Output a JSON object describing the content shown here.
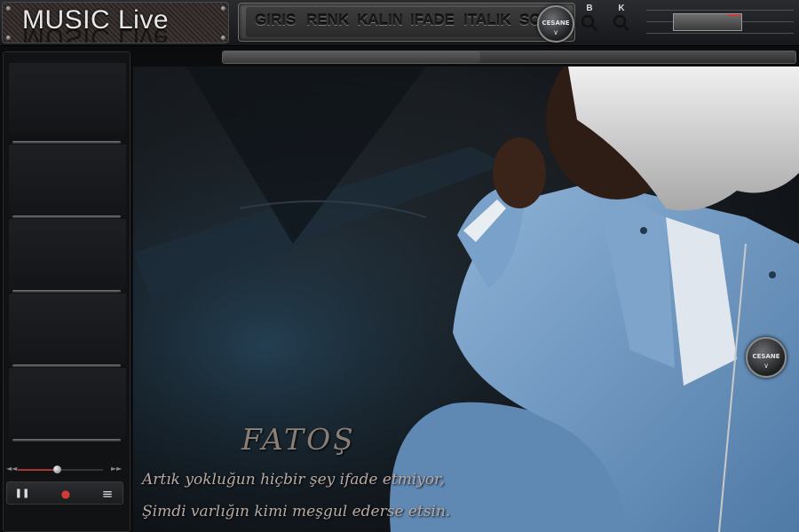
{
  "app": {
    "logo_text": "MUSIC Live"
  },
  "menu": {
    "items": [
      {
        "label": "GIRIS"
      },
      {
        "label": "RENK"
      },
      {
        "label": "KALIN"
      },
      {
        "label": "IFADE"
      },
      {
        "label": "ITALIK"
      },
      {
        "label": "SO"
      }
    ]
  },
  "badge": {
    "text": "CESANE",
    "chevron": "∨"
  },
  "tools": [
    {
      "letter": "B",
      "icon": "search-icon"
    },
    {
      "letter": "K",
      "icon": "search-icon"
    }
  ],
  "player": {
    "skip_back": "◄◄",
    "skip_forward": "►►",
    "pause": "❚❚",
    "record": "●",
    "menu": "≡",
    "progress": 0.45
  },
  "caption": {
    "name": "FATOŞ",
    "line1": "Artık yokluğun hiçbir şey ifade etmiyor,",
    "line2": "Şimdi varlığın kimi meşgul ederse etsin."
  },
  "colors": {
    "record_red": "#d23a3a",
    "jacket_blue": "#6f99c4",
    "hair_white": "#dcdcdc"
  }
}
